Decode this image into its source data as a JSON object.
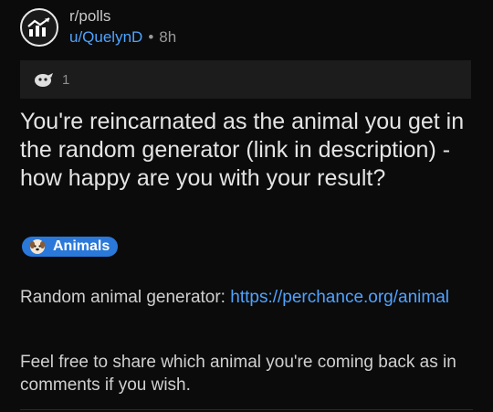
{
  "post": {
    "subreddit": "r/polls",
    "username": "u/QuelynD",
    "separator": "•",
    "age": "8h",
    "award_count": "1",
    "title": "You're reincarnated as the animal you get in the random generator (link in description) - how happy are you with your result?",
    "flair": {
      "label": "Animals",
      "icon": "dog-face-icon"
    },
    "body": {
      "p1_text": "Random animal generator: ",
      "p1_link": "https://perchance.org/animal",
      "p2": "Feel free to share which animal you're coming back as in comments if you wish."
    }
  },
  "icons": {
    "subreddit": "chart-icon",
    "award": "award-icon"
  },
  "colors": {
    "link": "#4fa3ff",
    "flair_bg": "#2a78d9",
    "background": "#0b0b0b",
    "awards_bar": "#1c1c1d"
  }
}
